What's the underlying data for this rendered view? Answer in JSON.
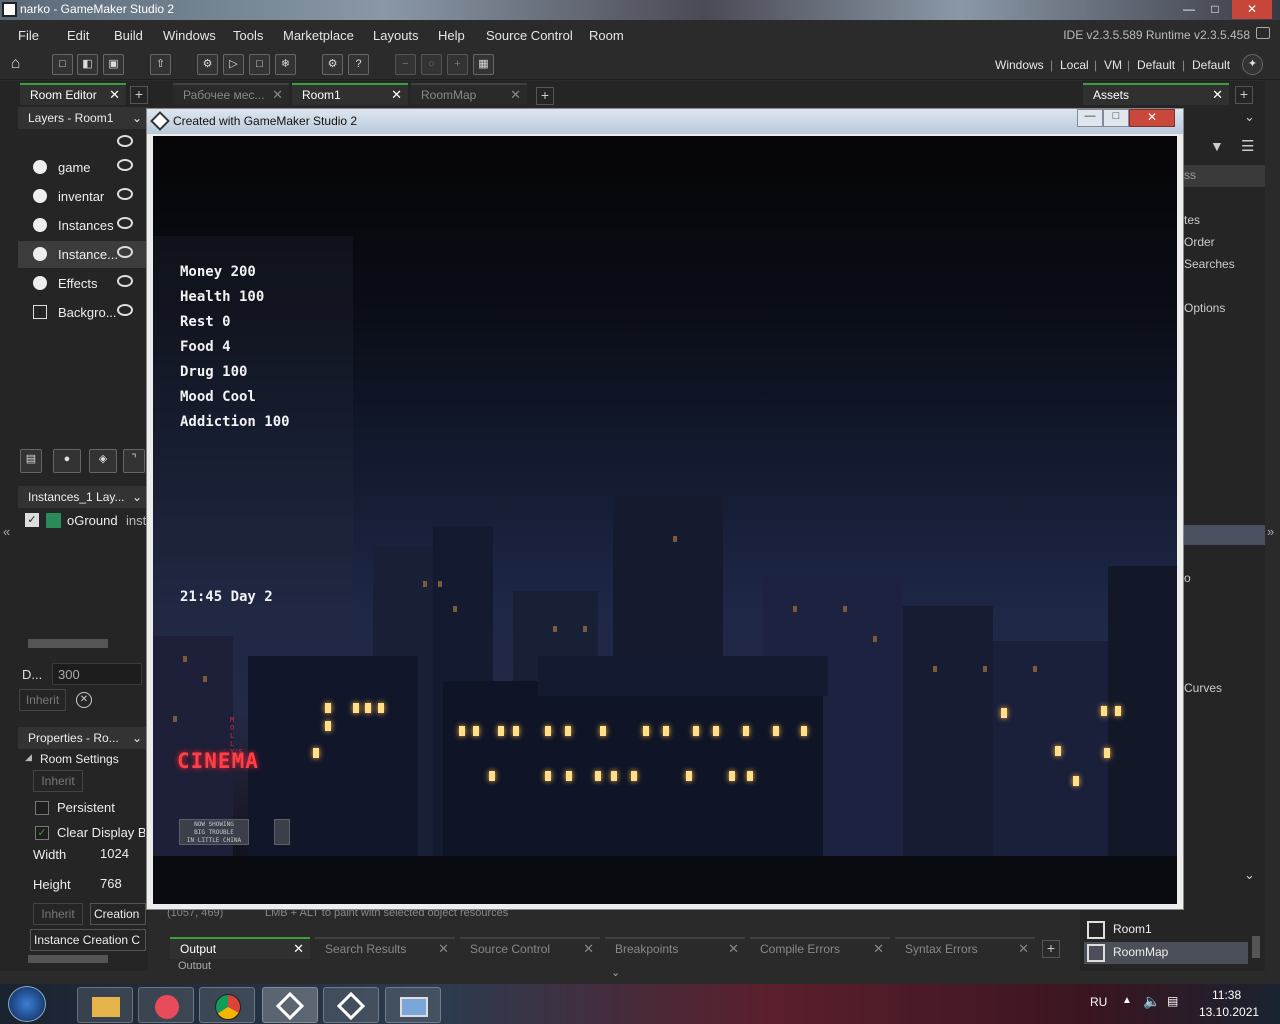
{
  "window": {
    "title": "narko - GameMaker Studio 2"
  },
  "menu": [
    "File",
    "Edit",
    "Build",
    "Windows",
    "Tools",
    "Marketplace",
    "Layouts",
    "Help",
    "Source Control",
    "Room"
  ],
  "version": "IDE v2.3.5.589  Runtime v2.3.5.458",
  "target": [
    "Windows",
    "|",
    "Local",
    "|",
    "VM",
    "|",
    "Default",
    "|",
    "Default"
  ],
  "left_tabs": {
    "room_editor": "Room Editor"
  },
  "layers": {
    "header": "Layers - Room1",
    "items": [
      "game",
      "inventar",
      "Instances",
      "Instance...",
      "Effects",
      "Backgro..."
    ]
  },
  "instances_panel": {
    "header": "Instances_1 Lay...",
    "item_name": "oGround",
    "item_suffix": "inst"
  },
  "depth": {
    "label": "D...",
    "value": "300",
    "inherit": "Inherit"
  },
  "properties": {
    "header": "Properties - Ro...",
    "room_settings": "Room Settings",
    "inherit": "Inherit",
    "persistent": "Persistent",
    "clear_display": "Clear Display B",
    "width_label": "Width",
    "width_value": "1024",
    "height_label": "Height",
    "height_value": "768",
    "creation_btn": "Creation",
    "instance_creation": "Instance Creation C"
  },
  "doc_tabs": [
    "Рабочее мес...",
    "Room1",
    "RoomMap"
  ],
  "game_window": {
    "title": "Created with GameMaker Studio 2"
  },
  "hud": {
    "money": "Money 200",
    "health": "Health 100",
    "rest": "Rest 0",
    "food": "Food 4",
    "drug": "Drug 100",
    "mood": "Mood Cool",
    "addiction": "Addiction 100",
    "clock": "21:45 Day 2"
  },
  "cinema": {
    "sign": "CINEMA",
    "side": "MOLLY'S",
    "board": [
      "NOW SHOWING",
      "BIG TROUBLE",
      "IN LITTLE CHINA"
    ]
  },
  "assets": {
    "tab": "Assets",
    "partial": [
      "ss",
      "tes",
      "Order",
      "Searches",
      "Options",
      "o",
      "Curves"
    ],
    "rooms": [
      "Room1",
      "RoomMap"
    ]
  },
  "status": {
    "coords": "(1057, 469)",
    "hint": "LMB + ALT to paint with selected object resources"
  },
  "output_tabs": [
    "Output",
    "Search Results",
    "Source Control",
    "Breakpoints",
    "Compile Errors",
    "Syntax Errors"
  ],
  "output_label": "Output",
  "taskbar": {
    "lang": "RU",
    "time": "11:38",
    "date": "13.10.2021"
  }
}
